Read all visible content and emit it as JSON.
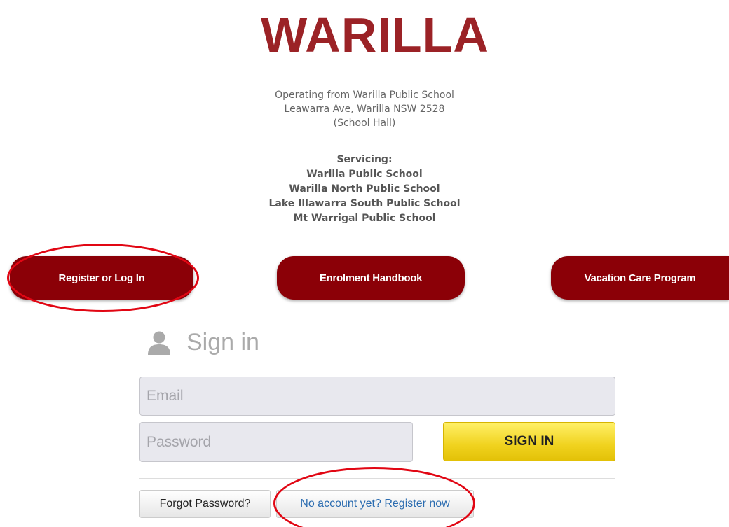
{
  "header": {
    "logo_text": "WARILLA",
    "address_lines": [
      "Operating from Warilla Public School",
      "Leawarra Ave, Warilla NSW 2528",
      "(School Hall)"
    ],
    "servicing_title": "Servicing:",
    "servicing_schools": [
      "Warilla Public School",
      "Warilla North Public School",
      "Lake Illawarra South Public School",
      "Mt Warrigal Public School"
    ]
  },
  "nav": {
    "register_login": "Register or Log In",
    "enrolment_handbook": "Enrolment Handbook",
    "vacation_care": "Vacation Care Program"
  },
  "signin": {
    "title": "Sign in",
    "email_placeholder": "Email",
    "password_placeholder": "Password",
    "submit_label": "SIGN IN",
    "forgot_label": "Forgot Password?",
    "register_label": "No account yet? Register now"
  },
  "colors": {
    "brand": "#9b2226",
    "nav_button": "#8b0007",
    "signin_button": "#f0d21e",
    "annotation": "#e10613",
    "link": "#2b6cb0"
  },
  "icons": {
    "signin_icon": "user-icon"
  }
}
